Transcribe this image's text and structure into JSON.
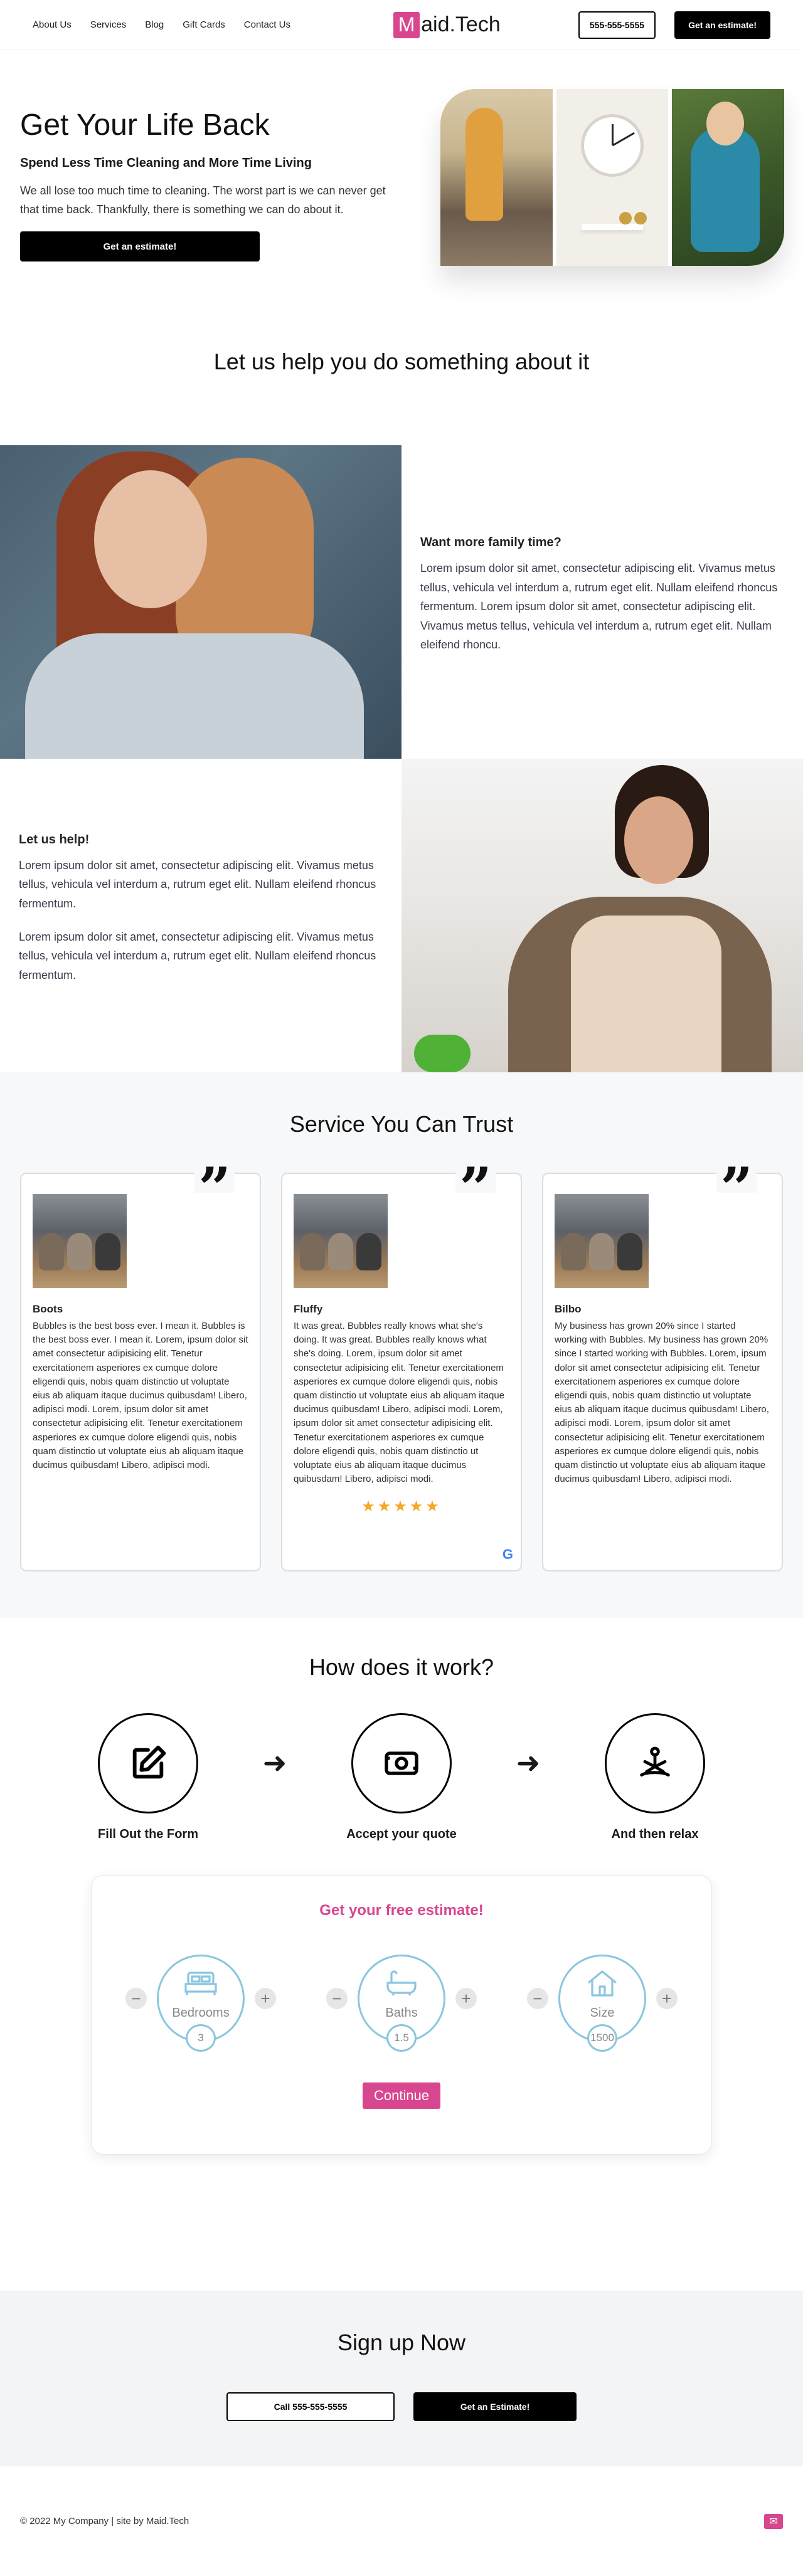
{
  "nav": {
    "links": [
      "About Us",
      "Services",
      "Blog",
      "Gift Cards",
      "Contact Us"
    ],
    "logo_mark": "M",
    "logo_text": "aid.Tech",
    "phone_label": "555-555-5555",
    "estimate_label": "Get an estimate!"
  },
  "hero": {
    "title": "Get Your Life Back",
    "subtitle": "Spend Less Time Cleaning and More Time Living",
    "text": "We all lose too much time to cleaning. The worst part is we can never get that time back. Thankfully, there is something we can do about it.",
    "button_label": "Get an estimate!"
  },
  "help": {
    "title": "Let us help you do something about it",
    "family_heading": "Want more family time?",
    "family_text": "Lorem ipsum dolor sit amet, consectetur adipiscing elit. Vivamus metus tellus, vehicula vel interdum a, rutrum eget elit. Nullam eleifend rhoncus fermentum. Lorem ipsum dolor sit amet, consectetur adipiscing elit. Vivamus metus tellus, vehicula vel interdum a, rutrum eget elit. Nullam eleifend rhoncu.",
    "help_heading": "Let us help!",
    "help_text_1": "Lorem ipsum dolor sit amet, consectetur adipiscing elit. Vivamus metus tellus, vehicula vel interdum a, rutrum eget elit. Nullam eleifend rhoncus fermentum.",
    "help_text_2": "Lorem ipsum dolor sit amet, consectetur adipiscing elit. Vivamus metus tellus, vehicula vel interdum a, rutrum eget elit. Nullam eleifend rhoncus fermentum."
  },
  "trust": {
    "title": "Service You Can Trust",
    "quote_glyph": "”",
    "cards": [
      {
        "name": "Boots",
        "text": "Bubbles is the best boss ever. I mean it. Bubbles is the best boss ever. I mean it. Lorem, ipsum dolor sit amet consectetur adipisicing elit. Tenetur exercitationem asperiores ex cumque dolore eligendi quis, nobis quam distinctio ut voluptate eius ab aliquam itaque ducimus quibusdam! Libero, adipisci modi. Lorem, ipsum dolor sit amet consectetur adipisicing elit. Tenetur exercitationem asperiores ex cumque dolore eligendi quis, nobis quam distinctio ut voluptate eius ab aliquam itaque ducimus quibusdam! Libero, adipisci modi."
      },
      {
        "name": "Fluffy",
        "text": "It was great. Bubbles really knows what she's doing. It was great. Bubbles really knows what she's doing. Lorem, ipsum dolor sit amet consectetur adipisicing elit. Tenetur exercitationem asperiores ex cumque dolore eligendi quis, nobis quam distinctio ut voluptate eius ab aliquam itaque ducimus quibusdam! Libero, adipisci modi. Lorem, ipsum dolor sit amet consectetur adipisicing elit. Tenetur exercitationem asperiores ex cumque dolore eligendi quis, nobis quam distinctio ut voluptate eius ab aliquam itaque ducimus quibusdam! Libero, adipisci modi.",
        "rating": 5,
        "stars": "★★★★★"
      },
      {
        "name": "Bilbo",
        "text": "My business has grown 20% since I started working with Bubbles. My business has grown 20% since I started working with Bubbles. Lorem, ipsum dolor sit amet consectetur adipisicing elit. Tenetur exercitationem asperiores ex cumque dolore eligendi quis, nobis quam distinctio ut voluptate eius ab aliquam itaque ducimus quibusdam! Libero, adipisci modi. Lorem, ipsum dolor sit amet consectetur adipisicing elit. Tenetur exercitationem asperiores ex cumque dolore eligendi quis, nobis quam distinctio ut voluptate eius ab aliquam itaque ducimus quibusdam! Libero, adipisci modi."
      }
    ]
  },
  "how": {
    "title": "How does it work?",
    "steps": [
      {
        "label": "Fill Out the Form",
        "icon": "edit-icon"
      },
      {
        "label": "Accept your quote",
        "icon": "money-icon"
      },
      {
        "label": "And then relax",
        "icon": "meditation-icon"
      }
    ]
  },
  "estimate": {
    "title": "Get your free estimate!",
    "dials": [
      {
        "label": "Bedrooms",
        "value": "3",
        "icon": "bed-icon"
      },
      {
        "label": "Baths",
        "value": "1.5",
        "icon": "bath-icon"
      },
      {
        "label": "Size",
        "value": "1500",
        "icon": "house-icon"
      }
    ],
    "continue_label": "Continue"
  },
  "signup": {
    "title": "Sign up Now",
    "call_label": "Call 555-555-5555",
    "estimate_label": "Get an Estimate!"
  },
  "footer": {
    "text": "© 2022 My Company  |  site by Maid.Tech"
  },
  "colors": {
    "brand": "#d8468f",
    "accent_blue": "#8ac6df",
    "star": "#f5a623"
  }
}
